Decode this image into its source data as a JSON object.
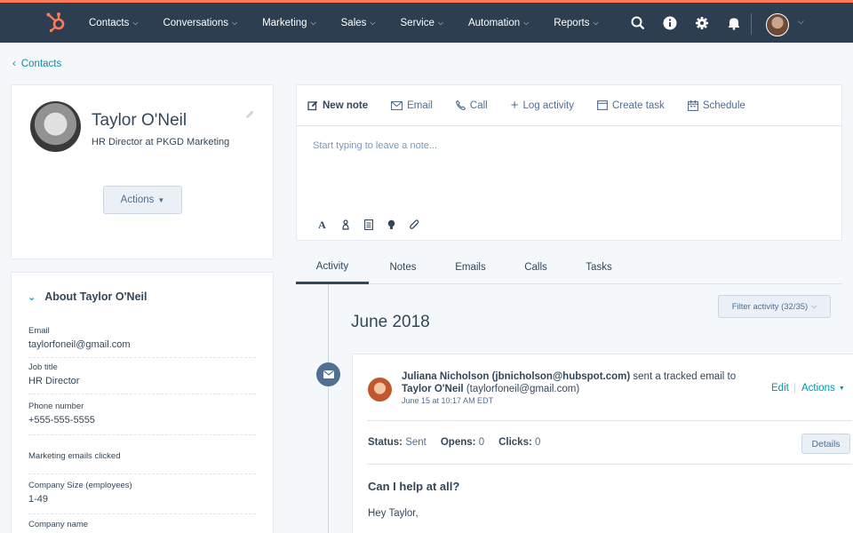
{
  "nav": {
    "items": [
      {
        "label": "Contacts"
      },
      {
        "label": "Conversations"
      },
      {
        "label": "Marketing"
      },
      {
        "label": "Sales"
      },
      {
        "label": "Service"
      },
      {
        "label": "Automation"
      },
      {
        "label": "Reports"
      }
    ],
    "icons": [
      "search-icon",
      "info-icon",
      "gear-icon",
      "bell-icon"
    ]
  },
  "breadcrumb": {
    "label": "Contacts"
  },
  "profile": {
    "name": "Taylor O'Neil",
    "title": "HR Director at PKGD Marketing",
    "actions_label": "Actions"
  },
  "about": {
    "header": "About Taylor O'Neil",
    "fields": [
      {
        "label": "Email",
        "value": "taylorfoneil@gmail.com"
      },
      {
        "label": "Job title",
        "value": "HR Director"
      },
      {
        "label": "Phone number",
        "value": "+555-555-5555"
      },
      {
        "label": "Marketing emails clicked",
        "value": ""
      },
      {
        "label": "Company Size (employees)",
        "value": "1-49"
      },
      {
        "label": "Company name",
        "value": ""
      }
    ]
  },
  "composer": {
    "tabs": [
      {
        "label": "New note",
        "icon": "pencil-square-icon"
      },
      {
        "label": "Email",
        "icon": "envelope-icon"
      },
      {
        "label": "Call",
        "icon": "phone-icon"
      },
      {
        "label": "Log activity",
        "icon": "plus-icon"
      },
      {
        "label": "Create task",
        "icon": "task-icon"
      },
      {
        "label": "Schedule",
        "icon": "calendar-icon"
      }
    ],
    "placeholder": "Start typing to leave a note...",
    "format_icons": [
      "text-format-icon",
      "person-mention-icon",
      "document-icon",
      "lightbulb-icon",
      "paperclip-icon"
    ]
  },
  "activity_tabs": [
    {
      "label": "Activity"
    },
    {
      "label": "Notes"
    },
    {
      "label": "Emails"
    },
    {
      "label": "Calls"
    },
    {
      "label": "Tasks"
    }
  ],
  "timeline": {
    "month": "June 2018",
    "filter_label": "Filter activity (32/35)"
  },
  "email": {
    "sender": "Juliana Nicholson (jbnicholson@hubspot.com)",
    "action_text": "sent a tracked email to",
    "recipient": "Taylor O'Neil",
    "recipient_email": "(taylorfoneil@gmail.com)",
    "date": "June 15 at 10:17 AM EDT",
    "edit_label": "Edit",
    "separator": "|",
    "actions_label": "Actions",
    "status_label": "Status:",
    "status_value": "Sent",
    "opens_label": "Opens:",
    "opens_value": "0",
    "clicks_label": "Clicks:",
    "clicks_value": "0",
    "details_label": "Details",
    "subject": "Can I help at all?",
    "body": "Hey Taylor,"
  },
  "colors": {
    "nav_bg": "#2d3e50",
    "accent_orange": "#ff7a59",
    "link": "#0091ae",
    "text": "#33475b"
  }
}
